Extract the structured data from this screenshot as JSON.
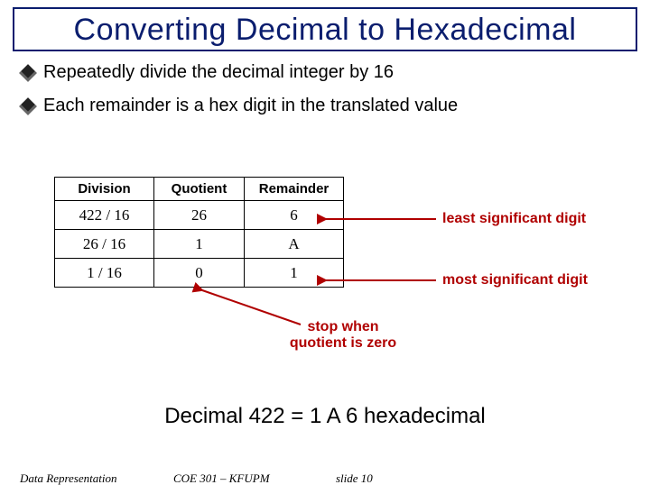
{
  "title": "Converting Decimal to Hexadecimal",
  "bullets": [
    "Repeatedly divide the decimal integer by 16",
    "Each remainder is a hex digit in the translated value"
  ],
  "table": {
    "headers": [
      "Division",
      "Quotient",
      "Remainder"
    ],
    "rows": [
      [
        "422 / 16",
        "26",
        "6"
      ],
      [
        "26 / 16",
        "1",
        "A"
      ],
      [
        "1 / 16",
        "0",
        "1"
      ]
    ]
  },
  "annotations": {
    "least": "least significant digit",
    "most": "most significant digit",
    "stop_l1": "stop when",
    "stop_l2": "quotient is zero"
  },
  "conclusion": "Decimal 422 = 1 A 6 hexadecimal",
  "footer": {
    "left": "Data Representation",
    "mid": "COE 301 – KFUPM",
    "slide": "slide 10"
  },
  "chart_data": {
    "type": "table",
    "title": "Converting Decimal to Hexadecimal",
    "headers": [
      "Division",
      "Quotient",
      "Remainder"
    ],
    "rows": [
      {
        "Division": "422 / 16",
        "Quotient": 26,
        "Remainder": "6"
      },
      {
        "Division": "26 / 16",
        "Quotient": 1,
        "Remainder": "A"
      },
      {
        "Division": "1 / 16",
        "Quotient": 0,
        "Remainder": "1"
      }
    ],
    "result": "Decimal 422 = 1A6 hexadecimal"
  }
}
